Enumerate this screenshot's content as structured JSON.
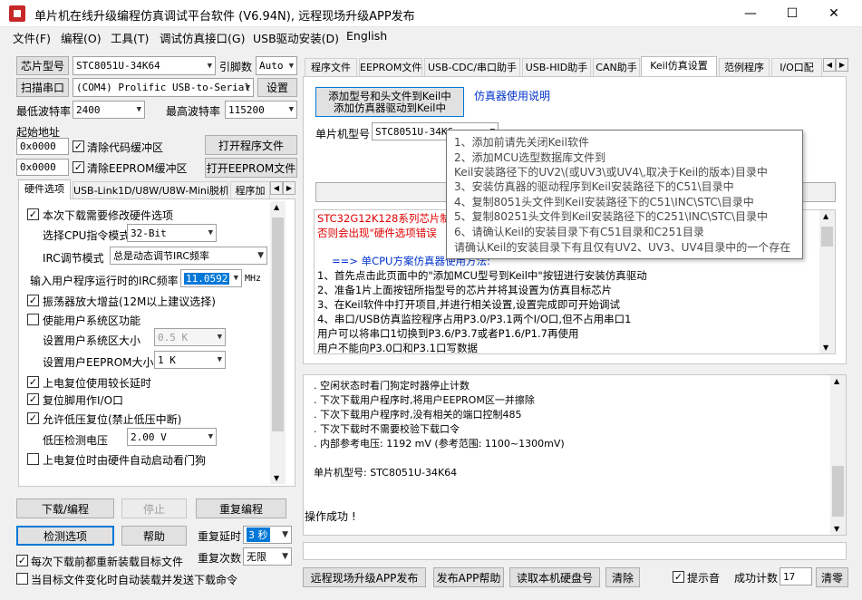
{
  "window": {
    "title": "单片机在线升级编程仿真调试平台软件 (V6.94N), 远程现场升级APP发布",
    "min_glyph": "—",
    "max_glyph": "☐",
    "close_glyph": "✕"
  },
  "menu": [
    "文件(F)",
    "编程(O)",
    "工具(T)",
    "调试仿真接口(G)",
    "USB驱动安装(D)",
    "English"
  ],
  "left": {
    "chip_model_button": "芯片型号",
    "chip_model_value": "STC8051U-34K64",
    "pin_label": "引脚数",
    "pin_value": "Auto",
    "scan_port_button": "扫描串口",
    "port_value": "(COM4) Prolific USB-to-Serial",
    "settings_button": "设置",
    "min_baud_label": "最低波特率",
    "min_baud_value": "2400",
    "max_baud_label": "最高波特率",
    "max_baud_value": "115200",
    "start_addr_label": "起始地址",
    "code_addr": "0x0000",
    "clear_code_label": "清除代码缓冲区",
    "open_program_button": "打开程序文件",
    "eeprom_addr": "0x0000",
    "clear_eeprom_label": "清除EEPROM缓冲区",
    "open_eeprom_button": "打开EEPROM文件",
    "hw_tabs": [
      "硬件选项",
      "USB-Link1D/U8W/U8W-Mini脱机",
      "程序加"
    ],
    "options": {
      "modify_hw": "本次下载需要修改硬件选项",
      "cpu_mode_label": "选择CPU指令模式",
      "cpu_mode_value": "32-Bit",
      "irc_mode_label": "IRC调节模式",
      "irc_mode_value": "总是动态调节IRC频率",
      "irc_freq_label": "输入用户程序运行时的IRC频率",
      "irc_freq_value": "11.0592",
      "irc_unit": "MHz",
      "osc_gain": "振荡器放大增益(12M以上建议选择)",
      "user_sys": "使能用户系统区功能",
      "sys_size_label": "设置用户系统区大小",
      "sys_size_value": "0.5 K",
      "eeprom_size_label": "设置用户EEPROM大小",
      "eeprom_size_value": "1   K",
      "long_delay": "上电复位使用较长延时",
      "reset_io": "复位脚用作I/O口",
      "low_volt_reset": "允许低压复位(禁止低压中断)",
      "low_volt_label": "低压检测电压",
      "low_volt_value": "2.00 V",
      "wdt": "上电复位时由硬件自动启动看门狗"
    },
    "download_button": "下载/编程",
    "stop_button": "停止",
    "reprogram_button": "重复编程",
    "detect_button": "检测选项",
    "help_button": "帮助",
    "repeat_delay_label": "重复延时",
    "repeat_delay_value": "3 秒",
    "repeat_count_label": "重复次数",
    "repeat_count_value": "无限",
    "reload_label": "每次下载前都重新装载目标文件",
    "auto_send_label": "当目标文件变化时自动装载并发送下载命令"
  },
  "right_tabs": [
    "程序文件",
    "EEPROM文件",
    "USB-CDC/串口助手",
    "USB-HID助手",
    "CAN助手",
    "Keil仿真设置",
    "范例程序",
    "I/O口配"
  ],
  "keil": {
    "add_button_line1": "添加型号和头文件到Keil中",
    "add_button_line2": "添加仿真器驱动到Keil中",
    "emu_manual_link": "仿真器使用说明",
    "mcu_label": "单片机型号",
    "mcu_value": "STC8051U-34K6",
    "serial_option": "使用串口进行仿真",
    "warning_line1": "STC32G12K128系列芯片制作",
    "warning_line2": "否则会出现\"硬件选项错误",
    "guide": [
      "==> 单CPU方案仿真器使用方法:",
      "1、首先点击此页面中的\"添加MCU型号到Keil中\"按钮进行安装仿真驱动",
      "2、准备1片上面按钮所指型号的芯片并将其设置为仿真目标芯片",
      "3、在Keil软件中打开项目,并进行相关设置,设置完成即可开始调试",
      "4、串口/USB仿真监控程序占用P3.0/P3.1两个I/O口,但不占用串口1",
      "   用户可以将串口1切换到P3.6/P3.7或者P1.6/P1.7再使用",
      "   用户不能向P3.0口和P3.1口写数据"
    ]
  },
  "tooltip": [
    "1、添加前请先关闭Keil软件",
    "2、添加MCU选型数据库文件到",
    "     Keil安装路径下的UV2\\(或UV3\\或UV4\\,取决于Keil的版本)目录中",
    "3、安装仿真器的驱动程序到Keil安装路径下的C51\\目录中",
    "4、复制8051头文件到Keil安装路径下的C51\\INC\\STC\\目录中",
    "5、复制80251头文件到Keil安装路径下的C251\\INC\\STC\\目录中",
    "6、请确认Keil的安装目录下有C51目录和C251目录",
    "     请确认Keil的安装目录下有且仅有UV2、UV3、UV4目录中的一个存在"
  ],
  "log": [
    ". 空闲状态时看门狗定时器停止计数",
    ". 下次下载用户程序时,将用户EEPROM区一并擦除",
    ". 下次下载用户程序时,没有相关的端口控制485",
    ". 下次下载时不需要校验下载口令",
    ". 内部参考电压: 1192 mV (参考范围: 1100~1300mV)",
    "",
    "  单片机型号: STC8051U-34K64",
    "",
    "",
    "",
    "操作成功 !"
  ],
  "bottom": {
    "remote_upgrade_button": "远程现场升级APP发布",
    "publish_help_button": "发布APP帮助",
    "read_disk_button": "读取本机硬盘号",
    "clear_button": "清除",
    "beep_label": "提示音",
    "success_count_label": "成功计数",
    "success_count_value": "17",
    "reset_count_button": "清零"
  },
  "colors": {
    "accent": "#0078d7",
    "warning_red": "#e00000",
    "link_blue": "#0033cc",
    "tooltip_text": "#4a4a4a"
  }
}
